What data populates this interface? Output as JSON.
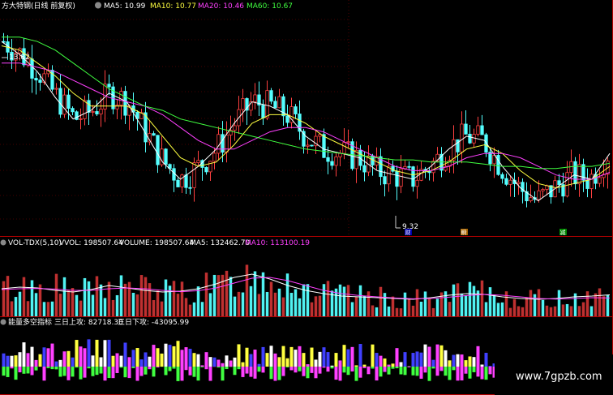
{
  "header": {
    "title": "方大特钢(日线 前复权)",
    "ma5": "MA5: 10.99",
    "ma10": "MA10: 10.77",
    "ma20": "MA20: 10.46",
    "ma60": "MA60: 10.67"
  },
  "vol_header": {
    "name": "VOL-TDX(5,10)",
    "vvol": "VVOL: 198507.64",
    "volume": "VOLUME: 198507.64",
    "ma5": "MA5: 132462.70",
    "ma10": "MA10: 113100.19"
  },
  "energy_header": {
    "name": "能量多空指标",
    "up": "三日上攻: 82718.30",
    "down": "三日下攻: -43095.99"
  },
  "annotations": {
    "high_price": "13.82",
    "low_price": "9.32",
    "badges": [
      "财",
      "瞬",
      "减"
    ]
  },
  "watermark": "www.7gpzb.com",
  "colors": {
    "up": "#ff4040",
    "down": "#54ffff",
    "ma5": "#ffffff",
    "ma10": "#ffff40",
    "ma20": "#ff40ff",
    "ma60": "#40ff40",
    "grid": "#8b0000"
  },
  "chart_data": [
    {
      "type": "candlestick",
      "title": "方大特钢(日线 前复权)",
      "ylim": [
        9.0,
        14.2
      ],
      "series": [
        {
          "name": "MA5",
          "values": [
            13.5,
            13.2,
            12.8,
            12.2,
            11.7,
            11.9,
            12.3,
            12.1,
            11.4,
            10.7,
            10.3,
            10.6,
            11.0,
            11.6,
            12.1,
            12.0,
            11.8,
            11.3,
            11.0,
            10.9,
            10.8,
            10.5,
            10.4,
            10.3,
            10.6,
            11.0,
            11.3,
            11.2,
            10.6,
            10.1,
            9.8,
            10.1,
            10.4,
            10.3,
            10.9
          ]
        },
        {
          "name": "MA10",
          "values": [
            13.4,
            13.3,
            13.0,
            12.7,
            12.3,
            12.0,
            12.0,
            12.0,
            11.8,
            11.3,
            10.8,
            10.6,
            10.7,
            11.1,
            11.6,
            11.8,
            11.8,
            11.6,
            11.3,
            11.1,
            10.9,
            10.7,
            10.5,
            10.4,
            10.5,
            10.7,
            11.0,
            11.1,
            10.9,
            10.5,
            10.2,
            10.1,
            10.2,
            10.3,
            10.6
          ]
        },
        {
          "name": "MA20",
          "values": [
            13.0,
            13.0,
            12.9,
            12.8,
            12.6,
            12.4,
            12.2,
            12.1,
            12.0,
            11.8,
            11.5,
            11.2,
            11.0,
            11.0,
            11.2,
            11.4,
            11.5,
            11.5,
            11.4,
            11.2,
            11.0,
            10.8,
            10.6,
            10.5,
            10.5,
            10.6,
            10.8,
            10.9,
            10.9,
            10.8,
            10.6,
            10.4,
            10.3,
            10.3,
            10.46
          ]
        },
        {
          "name": "MA60",
          "values": [
            13.6,
            13.6,
            13.5,
            13.3,
            13.0,
            12.7,
            12.4,
            12.2,
            12.0,
            11.9,
            11.7,
            11.6,
            11.5,
            11.4,
            11.3,
            11.2,
            11.1,
            11.0,
            10.95,
            10.9,
            10.85,
            10.8,
            10.75,
            10.75,
            10.7,
            10.7,
            10.7,
            10.65,
            10.6,
            10.6,
            10.55,
            10.55,
            10.6,
            10.6,
            10.67
          ]
        }
      ]
    },
    {
      "type": "bar",
      "title": "VOL-TDX(5,10)",
      "ylim": [
        0,
        420000
      ],
      "series": [
        {
          "name": "MA5",
          "values": [
            170000,
            180000,
            175000,
            160000,
            150000,
            165000,
            190000,
            175000,
            160000,
            150000,
            155000,
            170000,
            200000,
            240000,
            260000,
            230000,
            190000,
            160000,
            140000,
            125000,
            120000,
            115000,
            110000,
            105000,
            115000,
            130000,
            140000,
            135000,
            120000,
            110000,
            105000,
            110000,
            120000,
            125000,
            132462.7
          ]
        },
        {
          "name": "MA10",
          "values": [
            165000,
            170000,
            172000,
            168000,
            160000,
            160000,
            170000,
            175000,
            170000,
            160000,
            152000,
            158000,
            175000,
            205000,
            235000,
            240000,
            220000,
            190000,
            160000,
            140000,
            128000,
            120000,
            113000,
            108000,
            110000,
            118000,
            128000,
            135000,
            130000,
            120000,
            110000,
            106000,
            110000,
            115000,
            113100.19
          ]
        }
      ]
    },
    {
      "type": "bar",
      "title": "能量多空指标",
      "series": [
        {
          "name": "三日上攻",
          "values": [
            82718.3
          ]
        },
        {
          "name": "三日下攻",
          "values": [
            -43095.99
          ]
        }
      ]
    }
  ]
}
